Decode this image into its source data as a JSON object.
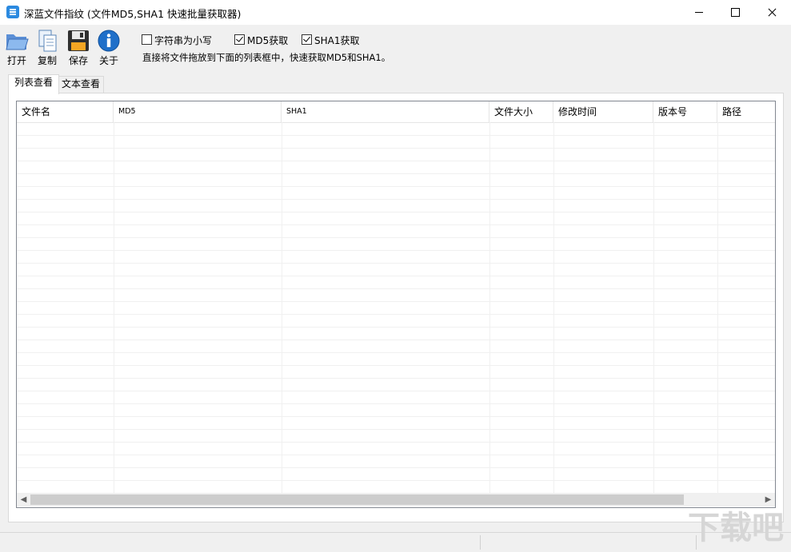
{
  "window": {
    "title": "深蓝文件指纹 (文件MD5,SHA1 快速批量获取器)"
  },
  "toolbar": {
    "open_label": "打开",
    "copy_label": "复制",
    "save_label": "保存",
    "about_label": "关于"
  },
  "options": {
    "lowercase": {
      "label": "字符串为小写",
      "checked": false
    },
    "md5": {
      "label": "MD5获取",
      "checked": true
    },
    "sha1": {
      "label": "SHA1获取",
      "checked": true
    },
    "hint": "直接将文件拖放到下面的列表框中，快速获取MD5和SHA1。"
  },
  "tabs": [
    {
      "label": "列表查看",
      "active": true
    },
    {
      "label": "文本查看",
      "active": false
    }
  ],
  "table": {
    "columns": [
      "文件名",
      "MD5",
      "SHA1",
      "文件大小",
      "修改时间",
      "版本号",
      "路径"
    ],
    "rows": []
  },
  "icons": {
    "open": "folder-open-icon",
    "copy": "copy-documents-icon",
    "save": "floppy-disk-icon",
    "about": "info-icon"
  },
  "colors": {
    "accent": "#1f6fc9",
    "window_bg": "#f0f0f0"
  },
  "watermark": "下载吧"
}
